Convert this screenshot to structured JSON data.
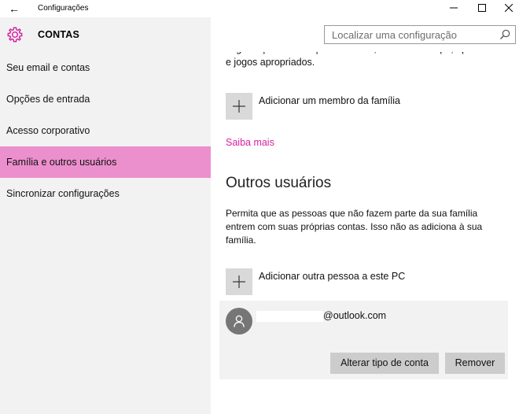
{
  "window": {
    "title": "Configurações",
    "minimize_glyph": "—",
    "maximize_glyph": "☐",
    "close_glyph": "✕",
    "back_glyph": "←"
  },
  "header": {
    "title": "CONTAS",
    "icon": "gear-icon",
    "accent": "#d6219f"
  },
  "search": {
    "placeholder": "Localizar uma configuração",
    "value": ""
  },
  "sidebar": {
    "items": [
      {
        "label": "Seu email e contas"
      },
      {
        "label": "Opções de entrada"
      },
      {
        "label": "Acesso corporativo"
      },
      {
        "label": "Família e outros usuários",
        "selected": true
      },
      {
        "label": "Sincronizar configurações"
      }
    ],
    "selected_color": "#ec8fcd"
  },
  "content": {
    "clipped_text": "segurança das crianças com sites, limites de tempo, aplicativos e jogos apropriados.",
    "add_family_label": "Adicionar um membro da família",
    "learn_more": "Saiba mais",
    "other_users_title": "Outros usuários",
    "other_users_desc": "Permita que as pessoas que não fazem parte da sua família entrem com suas próprias contas. Isso não as adiciona à sua família.",
    "add_other_label": "Adicionar outra pessoa a este PC",
    "user": {
      "email_suffix": "@outlook.com",
      "change_type_label": "Alterar tipo de conta",
      "remove_label": "Remover"
    }
  }
}
